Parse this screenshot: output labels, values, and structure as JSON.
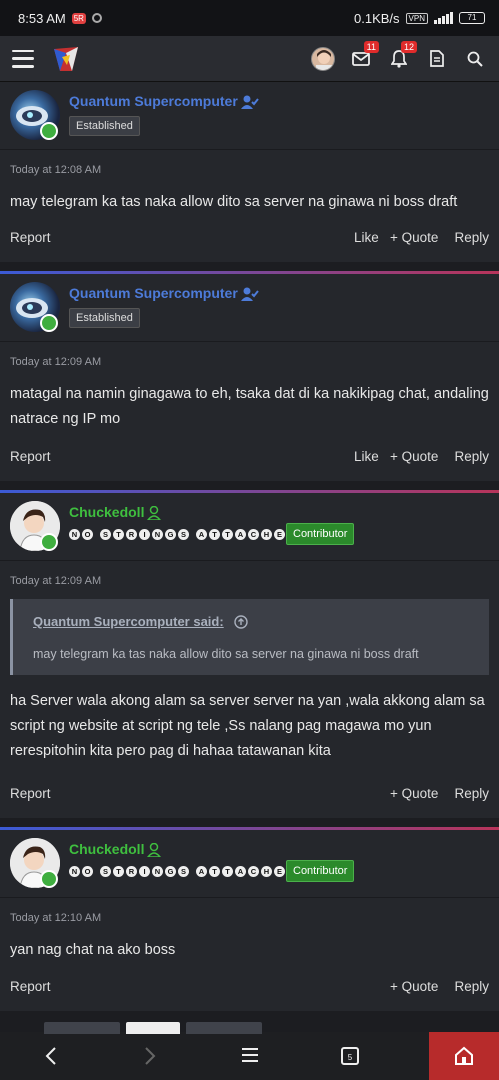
{
  "status": {
    "time": "8:53 AM",
    "badge": "5R",
    "speed": "0.1KB/s",
    "vpn": "VPN",
    "battery": "71"
  },
  "nav": {
    "alerts_count": "11",
    "inbox_count": "12"
  },
  "posts": [
    {
      "author": "Quantum Supercomputer",
      "title": "Established",
      "time": "Today at 12:08 AM",
      "body": "may telegram ka tas naka allow dito sa server na ginawa ni boss draft",
      "actions": {
        "report": "Report",
        "like": "Like",
        "quote": "Quote",
        "reply": "Reply"
      }
    },
    {
      "author": "Quantum Supercomputer",
      "title": "Established",
      "time": "Today at 12:09 AM",
      "body": "matagal na namin ginagawa to eh, tsaka dat di ka nakikipag chat, andaling natrace ng IP mo",
      "actions": {
        "report": "Report",
        "like": "Like",
        "quote": "Quote",
        "reply": "Reply"
      }
    },
    {
      "author": "Chuckedoll",
      "banner": "NO STRINGS ATTACHED",
      "role": "Contributor",
      "time": "Today at 12:09 AM",
      "quote": {
        "header": "Quantum Supercomputer said:",
        "text": "may telegram ka tas naka allow dito sa server na ginawa ni boss draft"
      },
      "body": "ha Server wala akong alam sa server server na yan ,wala akkong alam sa script ng website at script ng tele ,Ss nalang pag magawa mo yun rerespitohin kita pero pag di hahaa tatawanan kita",
      "actions": {
        "report": "Report",
        "quote": "Quote",
        "reply": "Reply"
      }
    },
    {
      "author": "Chuckedoll",
      "banner": "NO STRINGS ATTACHED",
      "role": "Contributor",
      "time": "Today at 12:10 AM",
      "body": "yan nag chat na ako boss",
      "actions": {
        "report": "Report",
        "quote": "Quote",
        "reply": "Reply"
      }
    }
  ],
  "colors": {
    "accent_blue": "#4d7bd9",
    "accent_green": "#3fbf3f",
    "badge_red": "#e02b2b",
    "contributor_green": "#2b8a2b"
  }
}
